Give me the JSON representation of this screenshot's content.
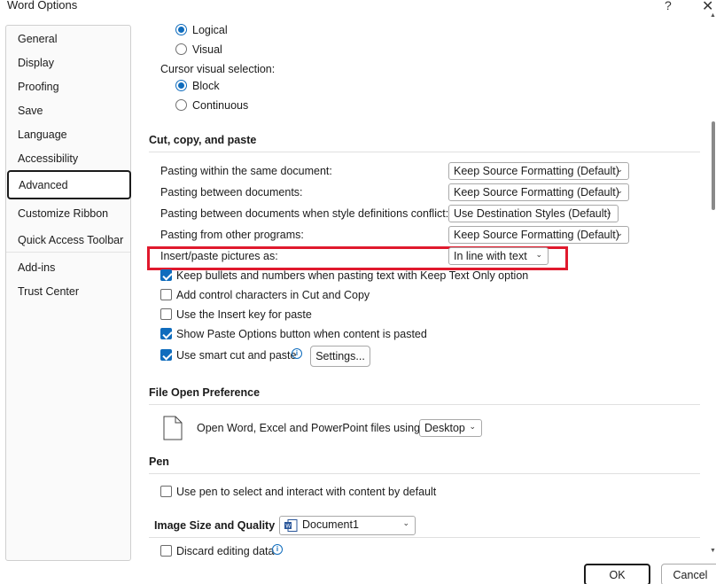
{
  "window": {
    "title": "Word Options",
    "help_label": "?",
    "close_label": "✕"
  },
  "sidebar": {
    "items": [
      {
        "label": "General"
      },
      {
        "label": "Display"
      },
      {
        "label": "Proofing"
      },
      {
        "label": "Save"
      },
      {
        "label": "Language"
      },
      {
        "label": "Accessibility"
      },
      {
        "label": "Advanced",
        "active": true
      },
      {
        "label": "Customize Ribbon"
      },
      {
        "label": "Quick Access Toolbar"
      },
      {
        "label": "Add-ins"
      },
      {
        "label": "Trust Center"
      }
    ]
  },
  "cursor_movement": {
    "logical_label": "Logical",
    "logical_selected": true,
    "visual_label": "Visual",
    "visual_selected": false
  },
  "cursor_selection": {
    "heading": "Cursor visual selection:",
    "block_label": "Block",
    "block_selected": true,
    "continuous_label": "Continuous",
    "continuous_selected": false
  },
  "cut_copy_paste": {
    "heading": "Cut, copy, and paste",
    "rows": [
      {
        "label": "Pasting within the same document:",
        "value": "Keep Source Formatting (Default)"
      },
      {
        "label": "Pasting between documents:",
        "value": "Keep Source Formatting (Default)"
      },
      {
        "label": "Pasting between documents when style definitions conflict:",
        "value": "Use Destination Styles (Default)"
      },
      {
        "label": "Pasting from other programs:",
        "value": "Keep Source Formatting (Default)"
      },
      {
        "label": "Insert/paste pictures as:",
        "value": "In line with text"
      }
    ],
    "checkboxes": [
      {
        "label": "Keep bullets and numbers when pasting text with Keep Text Only option",
        "checked": true
      },
      {
        "label": "Add control characters in Cut and Copy",
        "checked": false
      },
      {
        "label": "Use the Insert key for paste",
        "checked": false
      },
      {
        "label": "Show Paste Options button when content is pasted",
        "checked": true
      },
      {
        "label": "Use smart cut and paste",
        "checked": true
      }
    ],
    "settings_button": "Settings..."
  },
  "file_open": {
    "heading": "File Open Preference",
    "label": "Open Word, Excel and PowerPoint files using:",
    "value": "Desktop"
  },
  "pen": {
    "heading": "Pen",
    "checkbox_label": "Use pen to select and interact with content by default",
    "checked": false
  },
  "image_size": {
    "heading": "Image Size and Quality",
    "document_value": "Document1",
    "discard_label": "Discard editing data",
    "discard_checked": false
  },
  "footer": {
    "ok_label": "OK",
    "cancel_label": "Cancel"
  },
  "colors": {
    "accent": "#0f6cbd",
    "highlight_border": "#e0192d"
  }
}
